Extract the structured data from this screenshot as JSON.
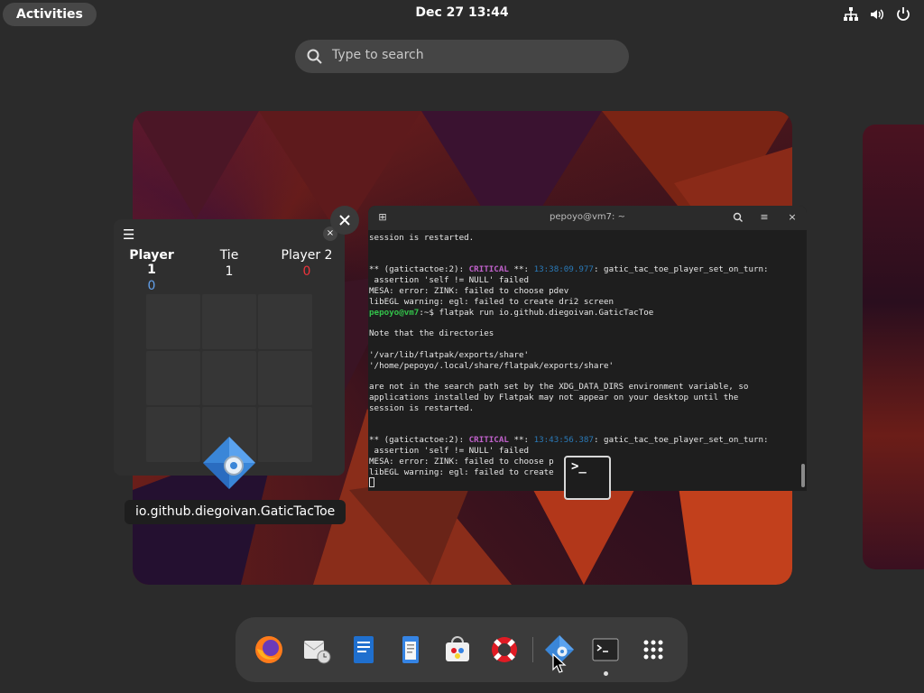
{
  "topbar": {
    "activities_label": "Activities",
    "clock": "Dec 27  13:44",
    "tray_icons": [
      "network-icon",
      "volume-icon",
      "power-icon"
    ]
  },
  "search": {
    "placeholder": "Type to search"
  },
  "game_window": {
    "menu_glyph": "☰",
    "close_glyph": "×",
    "player1_label": "Player 1",
    "player1_score": "0",
    "tie_label": "Tie",
    "tie_score": "1",
    "player2_label": "Player 2",
    "player2_score": "0"
  },
  "app_label": "io.github.diegoivan.GaticTacToe",
  "terminal": {
    "title": "pepoyo@vm7: ~",
    "lines": [
      "session is restarted.",
      "",
      "",
      "** (gatictactoe:2): CRITICAL **: 13:38:09.977: gatic_tac_toe_player_set_on_turn:",
      " assertion 'self != NULL' failed",
      "MESA: error: ZINK: failed to choose pdev",
      "libEGL warning: egl: failed to create dri2 screen",
      "pepoyo@vm7:~$ flatpak run io.github.diegoivan.GaticTacToe",
      "",
      "Note that the directories",
      "",
      "'/var/lib/flatpak/exports/share'",
      "'/home/pepoyo/.local/share/flatpak/exports/share'",
      "",
      "are not in the search path set by the XDG_DATA_DIRS environment variable, so",
      "applications installed by Flatpak may not appear on your desktop until the",
      "session is restarted.",
      "",
      "",
      "** (gatictactoe:2): CRITICAL **: 13:43:56.387: gatic_tac_toe_player_set_on_turn:",
      " assertion 'self != NULL' failed",
      "MESA: error: ZINK: failed to choose p",
      "libEGL warning: egl: failed to create    reen"
    ],
    "colors": {
      "critical": "#c061cb",
      "timestamp": "#2a7ab8",
      "prompt": "#33c24a"
    }
  },
  "terminal_thumb_glyph": ">_",
  "dock": {
    "items": [
      "firefox-icon",
      "mail-clock-icon",
      "writer-document-icon",
      "text-editor-icon",
      "software-store-icon",
      "help-lifebuoy-icon",
      "gatictactoe-icon",
      "terminal-icon",
      "app-grid-icon"
    ]
  }
}
